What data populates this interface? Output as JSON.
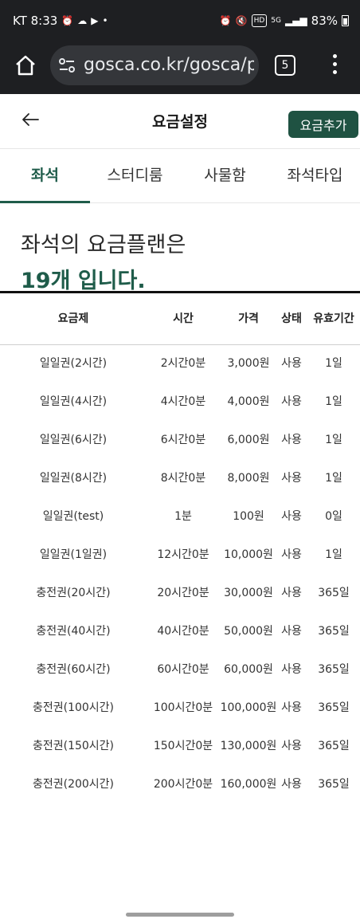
{
  "status_bar": {
    "carrier_time": "KT 8:33",
    "battery": "83%"
  },
  "browser": {
    "url": "gosca.co.kr/gosca/p",
    "tab_count": "5"
  },
  "header": {
    "title": "요금설정",
    "add_button": "요금추가"
  },
  "tabs": [
    "좌석",
    "스터디룸",
    "사물함",
    "좌석타입"
  ],
  "summary": {
    "line1": "좌석의 요금플랜은",
    "line2": "19개 입니다."
  },
  "table": {
    "columns": [
      "요금제",
      "시간",
      "가격",
      "상태",
      "유효기간"
    ],
    "rows": [
      {
        "name": "일일권(2시간)",
        "time": "2시간0분",
        "price": "3,000원",
        "status": "사용",
        "valid": "1일"
      },
      {
        "name": "일일권(4시간)",
        "time": "4시간0분",
        "price": "4,000원",
        "status": "사용",
        "valid": "1일"
      },
      {
        "name": "일일권(6시간)",
        "time": "6시간0분",
        "price": "6,000원",
        "status": "사용",
        "valid": "1일"
      },
      {
        "name": "일일권(8시간)",
        "time": "8시간0분",
        "price": "8,000원",
        "status": "사용",
        "valid": "1일"
      },
      {
        "name": "일일권(test)",
        "time": "1분",
        "price": "100원",
        "status": "사용",
        "valid": "0일"
      },
      {
        "name": "일일권(1일권)",
        "time": "12시간0분",
        "price": "10,000원",
        "status": "사용",
        "valid": "1일"
      },
      {
        "name": "충전권(20시간)",
        "time": "20시간0분",
        "price": "30,000원",
        "status": "사용",
        "valid": "365일"
      },
      {
        "name": "충전권(40시간)",
        "time": "40시간0분",
        "price": "50,000원",
        "status": "사용",
        "valid": "365일"
      },
      {
        "name": "충전권(60시간)",
        "time": "60시간0분",
        "price": "60,000원",
        "status": "사용",
        "valid": "365일"
      },
      {
        "name": "충전권(100시간)",
        "time": "100시간0분",
        "price": "100,000원",
        "status": "사용",
        "valid": "365일"
      },
      {
        "name": "충전권(150시간)",
        "time": "150시간0분",
        "price": "130,000원",
        "status": "사용",
        "valid": "365일"
      },
      {
        "name": "충전권(200시간)",
        "time": "200시간0분",
        "price": "160,000원",
        "status": "사용",
        "valid": "365일"
      }
    ]
  }
}
